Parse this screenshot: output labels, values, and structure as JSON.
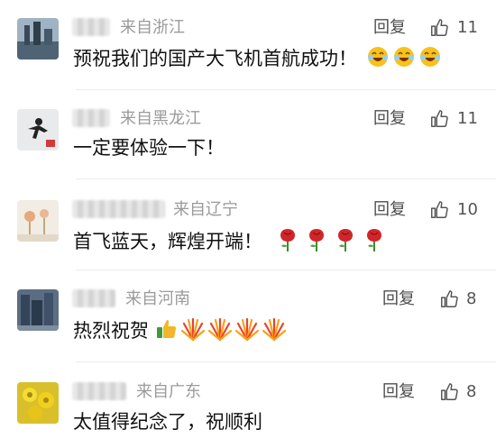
{
  "comments": [
    {
      "location": "来自浙江",
      "reply": "回复",
      "likes": "11",
      "text": "预祝我们的国产大飞机首航成功！",
      "emoji": [
        "laughing-emoji",
        "laughing-emoji",
        "laughing-emoji"
      ]
    },
    {
      "location": "来自黑龙江",
      "reply": "回复",
      "likes": "11",
      "text": "一定要体验一下！",
      "emoji": []
    },
    {
      "location": "来自辽宁",
      "reply": "回复",
      "likes": "10",
      "text": "首飞蓝天，辉煌开端！",
      "emoji": [
        "rose-emoji",
        "rose-emoji",
        "rose-emoji",
        "rose-emoji"
      ]
    },
    {
      "location": "来自河南",
      "reply": "回复",
      "likes": "8",
      "text": "热烈祝贺",
      "emoji": [
        "thumbs-up-emoji",
        "firework-emoji",
        "firework-emoji",
        "firework-emoji",
        "firework-emoji"
      ]
    },
    {
      "location": "来自广东",
      "reply": "回复",
      "likes": "8",
      "text": "太值得纪念了，祝顺利",
      "emoji": []
    }
  ]
}
